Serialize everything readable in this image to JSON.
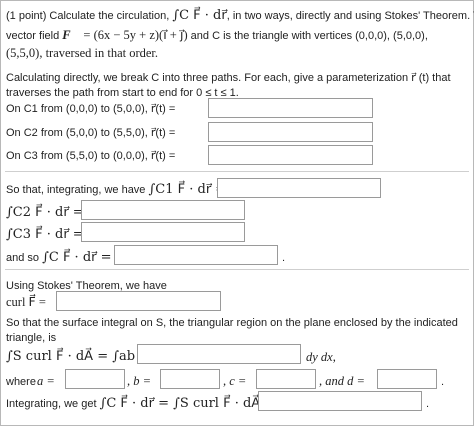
{
  "problem": {
    "points": "(1 point)",
    "intro": "Calculate the circulation,",
    "intro_tail": ", in two ways, directly and using Stokes' Theorem. The",
    "vf_label": "vector field",
    "vf_expr": "= (6x − 5y + z)(i⃗ + j⃗)",
    "vf_tail": "and C is the triangle with vertices (0,0,0), (5,0,0),",
    "vf_line3": "(5,5,0), traversed in that order.",
    "circ_symbol": "∫C F⃗ · dr⃗"
  },
  "direct": {
    "line1": "Calculating directly, we break C into three paths. For each, give a parameterization r⃗ (t) that",
    "line2": "traverses the path from start to end for 0 ≤ t ≤ 1.",
    "paths": [
      {
        "label": "On C1 from (0,0,0) to (5,0,0), r⃗(t) ="
      },
      {
        "label": "On C2 from (5,0,0) to (5,5,0), r⃗(t) ="
      },
      {
        "label": "On C3 from (5,5,0) to (0,0,0), r⃗(t) ="
      }
    ],
    "integrating_prefix": "So that, integrating, we have",
    "integrating_expr": "∫C1 F⃗ · dr⃗ =",
    "c2_expr": "∫C2 F⃗ · dr⃗ =",
    "c3_expr": "∫C3 F⃗ · dr⃗ =",
    "andso_prefix": "and so",
    "andso_expr": "∫C F⃗ · dr⃗ =",
    "period": "."
  },
  "stokes": {
    "line1": "Using Stokes' Theorem, we have",
    "curl_expr": "curl F⃗ =",
    "surface_line1": "So that the surface integral on S, the triangular region on the plane enclosed by the indicated",
    "surface_line2": "triangle, is",
    "surface_expr": "∫S curl F⃗ · dA⃗ = ∫ab ∫cd",
    "dydx": "dy dx,",
    "where": "where",
    "a_label": "a =",
    "b_label": ", b =",
    "c_label": ", c =",
    "d_label": ", and d =",
    "final_prefix": "Integrating, we get",
    "final_expr": "∫C F⃗ · dr⃗ = ∫S curl F⃗ · dA⃗ =",
    "period": "."
  }
}
